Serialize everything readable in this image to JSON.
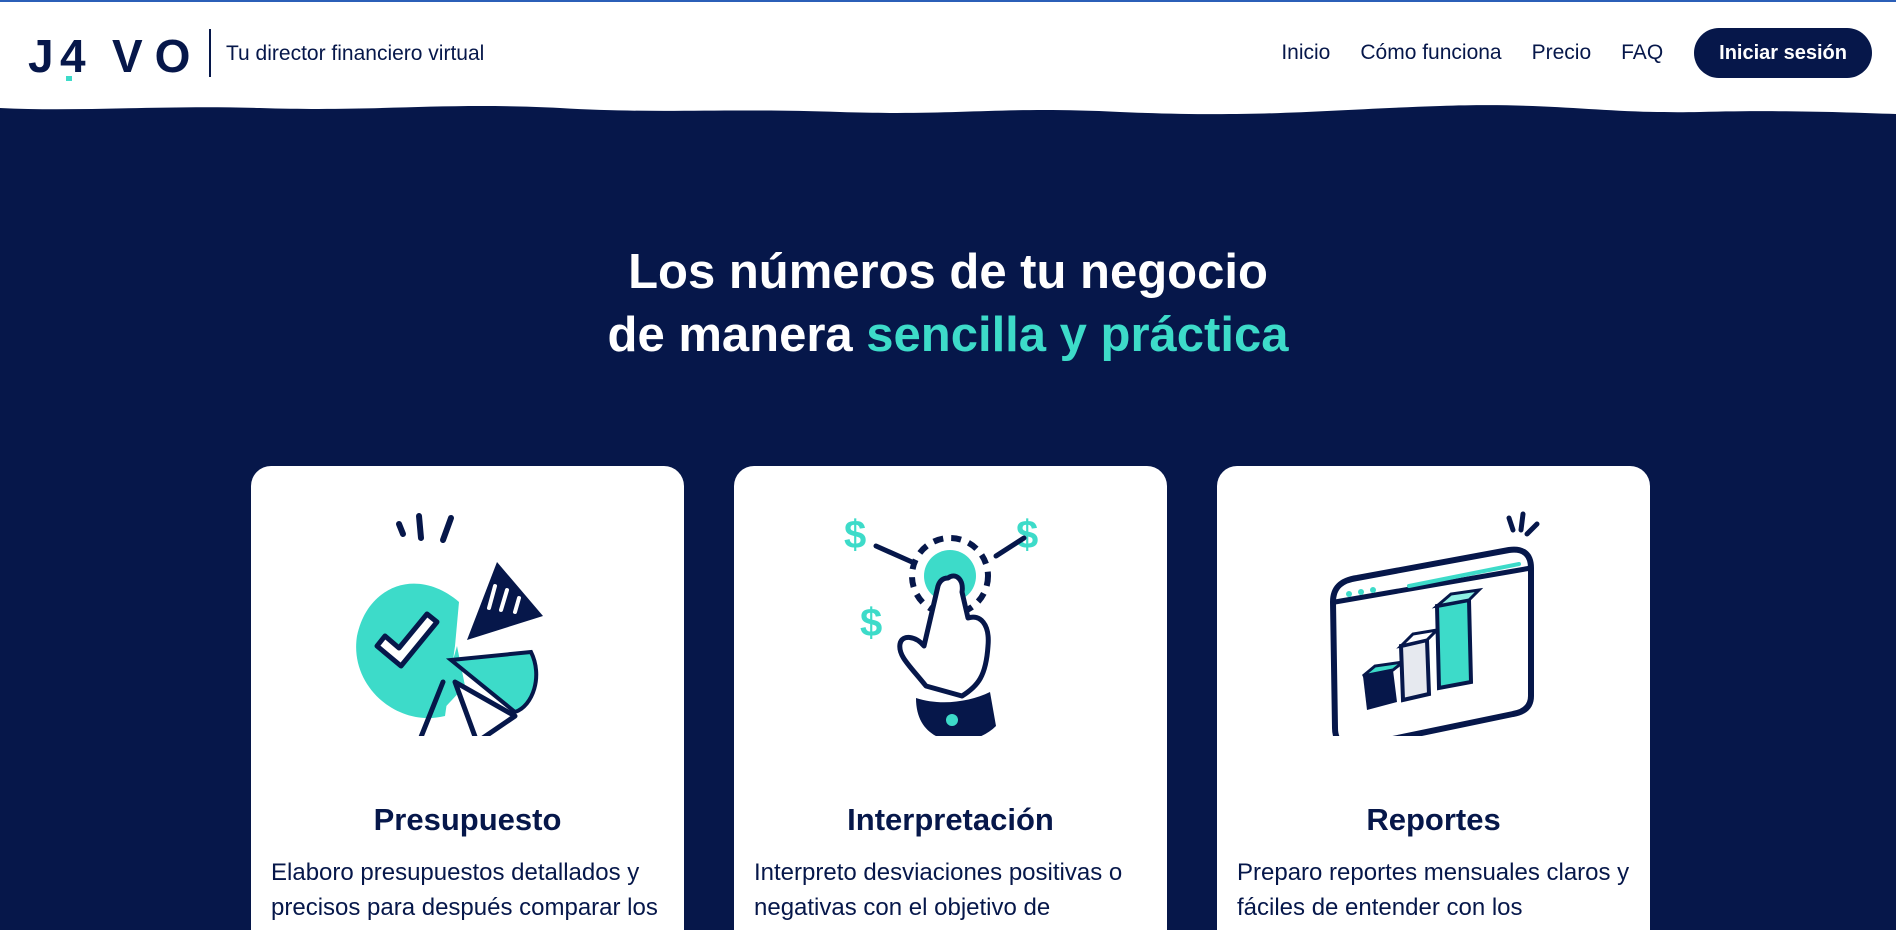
{
  "brand": {
    "logo_text": "J4VO",
    "tagline": "Tu director financiero virtual"
  },
  "nav": {
    "items": [
      "Inicio",
      "Cómo funciona",
      "Precio",
      "FAQ"
    ],
    "login_label": "Iniciar sesión"
  },
  "hero": {
    "line1": "Los números de tu negocio",
    "line2_prefix": "de manera ",
    "line2_accent": "sencilla y práctica"
  },
  "cards": [
    {
      "icon": "pie-chart-icon",
      "title": "Presupuesto",
      "text": "Elaboro presupuestos detallados y precisos para después comparar los"
    },
    {
      "icon": "hand-money-icon",
      "title": "Interpretación",
      "text": "Interpreto desviaciones positivas o negativas con el objetivo de"
    },
    {
      "icon": "report-chart-icon",
      "title": "Reportes",
      "text": "Preparo reportes mensuales claros y fáciles de entender con los"
    }
  ],
  "colors": {
    "navy": "#06174a",
    "accent": "#3ddbc9",
    "white": "#ffffff",
    "top_line": "#2b5fb8"
  }
}
